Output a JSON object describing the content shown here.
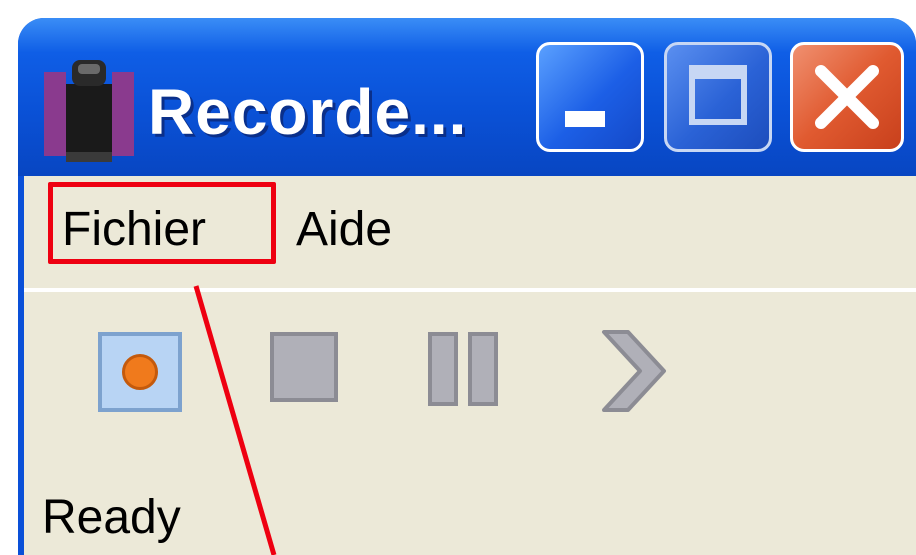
{
  "window": {
    "title": "Recorde...",
    "app_icon": "tape-recorder-icon"
  },
  "title_buttons": {
    "minimize": "minimize-icon",
    "maximize": "maximize-icon",
    "close": "close-icon"
  },
  "menu": {
    "items": [
      {
        "label": "Fichier",
        "highlighted": true
      },
      {
        "label": "Aide",
        "highlighted": false
      }
    ]
  },
  "toolbar": {
    "buttons": [
      {
        "icon": "record-icon",
        "active": true
      },
      {
        "icon": "stop-icon",
        "active": false
      },
      {
        "icon": "pause-icon",
        "active": false
      },
      {
        "icon": "play-icon",
        "active": false
      }
    ]
  },
  "status": {
    "text": "Ready"
  },
  "colors": {
    "titlebar": "#0a50d8",
    "client": "#ece9d8",
    "highlight": "#ee0011",
    "close_button": "#e05a30",
    "record_dot": "#f07a1c"
  }
}
